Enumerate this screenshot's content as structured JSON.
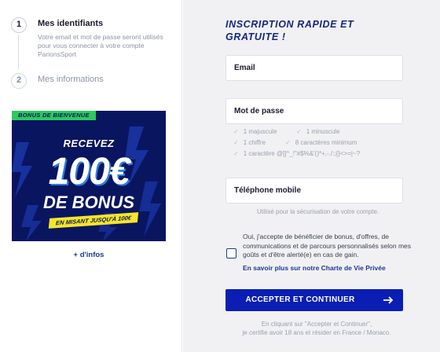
{
  "steps": [
    {
      "number": "1",
      "title": "Mes identifiants",
      "description": "Votre email et mot de passe seront utilisés pour vous connecter à votre compte ParionsSport"
    },
    {
      "number": "2",
      "title": "Mes informations"
    }
  ],
  "promo": {
    "banner": "BONUS DE BIENVENUE",
    "headline": "RECEVEZ",
    "amount": "100€",
    "subtitle": "DE BONUS",
    "tagline": "EN MISANT JUSQU'À 100€",
    "more_link": "+ d'infos"
  },
  "form": {
    "title": "INSCRIPTION RAPIDE ET GRATUITE !",
    "email_placeholder": "Email",
    "password_placeholder": "Mot de passe",
    "password_rules": {
      "uppercase": "1 majuscule",
      "lowercase": "1 minuscule",
      "digit": "1 chiffre",
      "min_length": "8 caractères minimum",
      "special": "1 caractère @[]^_!\"#$%&'()*+,-./:;{}<>=|~?"
    },
    "phone_placeholder": "Téléphone mobile",
    "phone_hint": "Utilisé pour la sécurisation de votre compte.",
    "consent_text": "Oui, j'accepte de bénéficier de bonus, d'offres, de communications et de parcours personnalisés selon mes goûts et d'être alerté(e) en cas de gain.",
    "privacy_link": "En savoir plus sur notre Charte de Vie Privée",
    "submit_label": "ACCEPTER ET CONTINUER",
    "legal_line1": "En cliquant sur \"Accepter et Continuer\",",
    "legal_line2": "je certifie avoir 18 ans et résider en France / Monaco."
  },
  "colors": {
    "primary": "#0a1eb4",
    "title": "#14287a",
    "promo_bg": "#0a1560",
    "promo_green": "#2ec95c",
    "promo_yellow": "#f5e629",
    "panel_bg": "#f1f1f4"
  },
  "icons": {
    "check": "check-icon",
    "arrow": "arrow-right-icon"
  }
}
